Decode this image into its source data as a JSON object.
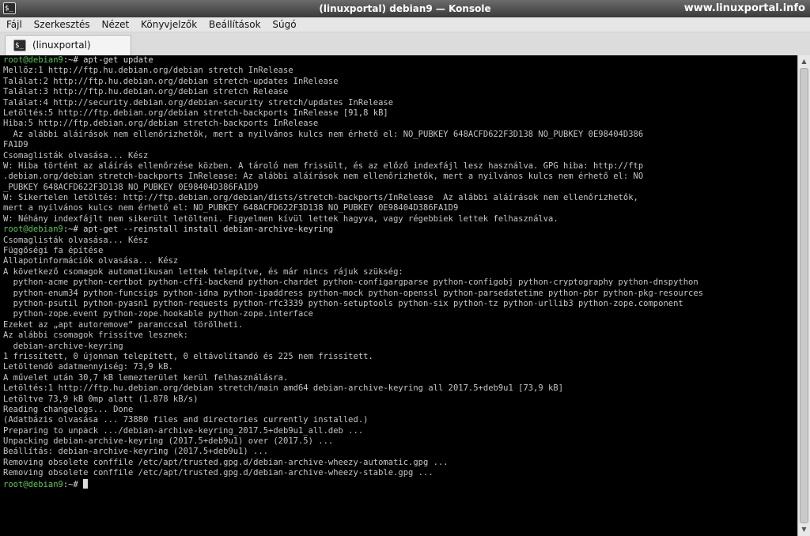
{
  "window": {
    "title": "(linuxportal) debian9 — Konsole",
    "watermark": "www.linuxportal.info",
    "app_icon": "$_"
  },
  "menu": [
    "Fájl",
    "Szerkesztés",
    "Nézet",
    "Könyvjelzők",
    "Beállítások",
    "Súgó"
  ],
  "tab": {
    "label": "(linuxportal) debian9",
    "icon": "$_"
  },
  "terminal": {
    "prompt": "root@debian9",
    "prompt_suffix": ":~# ",
    "lines": [
      {
        "type": "prompt",
        "text": "apt-get update"
      },
      {
        "type": "out",
        "text": "Mellőz:1 http://ftp.hu.debian.org/debian stretch InRelease"
      },
      {
        "type": "out",
        "text": "Találat:2 http://ftp.hu.debian.org/debian stretch-updates InRelease"
      },
      {
        "type": "out",
        "text": "Találat:3 http://ftp.hu.debian.org/debian stretch Release"
      },
      {
        "type": "out",
        "text": "Találat:4 http://security.debian.org/debian-security stretch/updates InRelease"
      },
      {
        "type": "out",
        "text": "Letöltés:5 http://ftp.debian.org/debian stretch-backports InRelease [91,8 kB]"
      },
      {
        "type": "out",
        "text": "Hiba:5 http://ftp.debian.org/debian stretch-backports InRelease"
      },
      {
        "type": "out",
        "text": "  Az alábbi aláírások nem ellenőrizhetők, mert a nyilvános kulcs nem érhető el: NO_PUBKEY 648ACFD622F3D138 NO_PUBKEY 0E98404D386"
      },
      {
        "type": "out",
        "text": "FA1D9"
      },
      {
        "type": "out",
        "text": "Csomaglisták olvasása... Kész"
      },
      {
        "type": "out",
        "text": "W: Hiba történt az aláírás ellenőrzése közben. A tároló nem frissült, és az előző indexfájl lesz használva. GPG hiba: http://ftp"
      },
      {
        "type": "out",
        "text": ".debian.org/debian stretch-backports InRelease: Az alábbi aláírások nem ellenőrizhetők, mert a nyilvános kulcs nem érhető el: NO"
      },
      {
        "type": "out",
        "text": "_PUBKEY 648ACFD622F3D138 NO_PUBKEY 0E98404D386FA1D9"
      },
      {
        "type": "out",
        "text": "W: Sikertelen letöltés: http://ftp.debian.org/debian/dists/stretch-backports/InRelease  Az alábbi aláírások nem ellenőrizhetők,"
      },
      {
        "type": "out",
        "text": "mert a nyilvános kulcs nem érhető el: NO_PUBKEY 648ACFD622F3D138 NO_PUBKEY 0E98404D386FA1D9"
      },
      {
        "type": "out",
        "text": "W: Néhány indexfájlt nem sikerült letölteni. Figyelmen kívül lettek hagyva, vagy régebbiek lettek felhasználva."
      },
      {
        "type": "prompt",
        "text": "apt-get --reinstall install debian-archive-keyring"
      },
      {
        "type": "out",
        "text": "Csomaglisták olvasása... Kész"
      },
      {
        "type": "out",
        "text": "Függőségi fa építése"
      },
      {
        "type": "out",
        "text": "Állapotinformációk olvasása... Kész"
      },
      {
        "type": "out",
        "text": "A következő csomagok automatikusan lettek telepítve, és már nincs rájuk szükség:"
      },
      {
        "type": "out",
        "text": "  python-acme python-certbot python-cffi-backend python-chardet python-configargparse python-configobj python-cryptography python-dnspython"
      },
      {
        "type": "out",
        "text": "  python-enum34 python-funcsigs python-idna python-ipaddress python-mock python-openssl python-parsedatetime python-pbr python-pkg-resources"
      },
      {
        "type": "out",
        "text": "  python-psutil python-pyasn1 python-requests python-rfc3339 python-setuptools python-six python-tz python-urllib3 python-zope.component"
      },
      {
        "type": "out",
        "text": "  python-zope.event python-zope.hookable python-zope.interface"
      },
      {
        "type": "out",
        "text": "Ezeket az „apt autoremove” paranccsal törölheti."
      },
      {
        "type": "out",
        "text": "Az alábbi csomagok frissítve lesznek:"
      },
      {
        "type": "out",
        "text": "  debian-archive-keyring"
      },
      {
        "type": "out",
        "text": "1 frissített, 0 újonnan telepített, 0 eltávolítandó és 225 nem frissített."
      },
      {
        "type": "out",
        "text": "Letöltendő adatmennyiség: 73,9 kB."
      },
      {
        "type": "out",
        "text": "A művelet után 30,7 kB lemezterület kerül felhasználásra."
      },
      {
        "type": "out",
        "text": "Letöltés:1 http://ftp.hu.debian.org/debian stretch/main amd64 debian-archive-keyring all 2017.5+deb9u1 [73,9 kB]"
      },
      {
        "type": "out",
        "text": "Letöltve 73,9 kB 0mp alatt (1.878 kB/s)"
      },
      {
        "type": "out",
        "text": "Reading changelogs... Done"
      },
      {
        "type": "out",
        "text": "(Adatbázis olvasása ... 73880 files and directories currently installed.)"
      },
      {
        "type": "out",
        "text": "Preparing to unpack .../debian-archive-keyring_2017.5+deb9u1_all.deb ..."
      },
      {
        "type": "out",
        "text": "Unpacking debian-archive-keyring (2017.5+deb9u1) over (2017.5) ..."
      },
      {
        "type": "out",
        "text": "Beállítás: debian-archive-keyring (2017.5+deb9u1) ..."
      },
      {
        "type": "out",
        "text": "Removing obsolete conffile /etc/apt/trusted.gpg.d/debian-archive-wheezy-automatic.gpg ..."
      },
      {
        "type": "out",
        "text": "Removing obsolete conffile /etc/apt/trusted.gpg.d/debian-archive-wheezy-stable.gpg ..."
      },
      {
        "type": "prompt",
        "text": "",
        "cursor": true
      }
    ]
  }
}
